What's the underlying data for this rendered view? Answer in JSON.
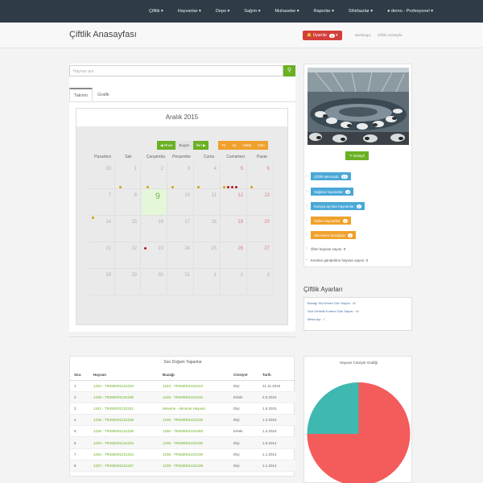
{
  "topnav": {
    "items": [
      "Çiftlik",
      "Hayvanlar",
      "Depo",
      "Sağım",
      "Muhasebe",
      "Raporlar",
      "Sihirbazlar"
    ],
    "user": "demo - Profesyonel"
  },
  "header": {
    "title": "Çiftlik Anasayfası",
    "alert_label": "Uyarılar",
    "alert_count": "1",
    "breadcrumb": [
      "Baslangıç",
      "Çiftlik Anasayfa"
    ]
  },
  "search": {
    "placeholder": "Hayvan ara"
  },
  "tabs": [
    "Takvim",
    "Grafik"
  ],
  "calendar": {
    "title": "Aralık 2015",
    "nav": {
      "prev": "Önce",
      "today": "Bugün",
      "next": "İleri"
    },
    "views": [
      "Yıl",
      "Ay",
      "Hafta",
      "Gün"
    ],
    "day_names": [
      "Pazartesi",
      "Salı",
      "Çarşamba",
      "Perşembe",
      "Cuma",
      "Cumartesi",
      "Pazar"
    ],
    "weeks": [
      [
        "30",
        "1",
        "2",
        "3",
        "4",
        "5",
        "6"
      ],
      [
        "7",
        "8",
        "9",
        "10",
        "11",
        "12",
        "13"
      ],
      [
        "14",
        "15",
        "16",
        "17",
        "18",
        "19",
        "20"
      ],
      [
        "21",
        "22",
        "23",
        "24",
        "25",
        "26",
        "27"
      ],
      [
        "28",
        "29",
        "30",
        "31",
        "1",
        "2",
        "3"
      ]
    ],
    "today": "9",
    "dot_colors": {
      "yellow": "#d6a400",
      "red": "#b21a1a"
    }
  },
  "sidebar": {
    "detail_button": "Detaylı",
    "stats": [
      {
        "label": "Çiftlik Mevcudu",
        "badge": "12",
        "color": "blue"
      },
      {
        "label": "Sağılan hayvanlar",
        "badge": "4",
        "color": "blue"
      },
      {
        "label": "Kuruya ayrılan hayvanlar",
        "badge": "2",
        "color": "blue"
      },
      {
        "label": "Gebe Hayvanlar",
        "badge": "4",
        "color": "orange"
      },
      {
        "label": "Süt emen buzağılar",
        "badge": "2",
        "color": "orange"
      }
    ],
    "text_stats": [
      {
        "label": "Ölen hayvan sayısı:",
        "value": "0"
      },
      {
        "label": "Kesime gönderilen hayvan sayısı:",
        "value": "0"
      }
    ]
  },
  "settings": {
    "title": "Çiftlik Ayarları",
    "lines": [
      {
        "label": "Buzağı Süt Kesim Gün Sayısı:",
        "value": "60"
      },
      {
        "label": "Sod Gebelik Kontrol Gün Sayısı:",
        "value": "60"
      },
      {
        "label": "Mesa Ayı:",
        "value": "1"
      }
    ]
  },
  "births": {
    "title": "Son Doğum Yapanlar",
    "columns": [
      "Sıra",
      "Hayvan",
      "Buzağı",
      "Cinsiyet",
      "Tarih"
    ],
    "rows": [
      [
        "1",
        "1234 - TR450001231234",
        "1243 - TR450001231243",
        "Dişi",
        "21.11.2015"
      ],
      [
        "2",
        "1236 - TR450001231236",
        "1245 - TR450001231245",
        "Erkek",
        "2.5.2015"
      ],
      [
        "3",
        "1241 - TR450001231241",
        "deneme - deneme Hayvan",
        "Dişi",
        "1.5.2015"
      ],
      [
        "4",
        "1236 - TR450001231236",
        "1235 - TR450001231235",
        "Dişi",
        "1.3.2015"
      ],
      [
        "5",
        "1236 - TR450001231236",
        "1250 - TR450001231250",
        "Erkek",
        "1.2.2015"
      ],
      [
        "6",
        "1234 - TR450001231234",
        "1235 - TR450001231235",
        "Dişi",
        "1.9.2014"
      ],
      [
        "7",
        "1234 - TR450001231234",
        "1236 - TR450001231236",
        "Dişi",
        "1.1.2014"
      ],
      [
        "8",
        "1237 - TR450001231237",
        "1238 - TR450001231238",
        "Dişi",
        "1.1.2014"
      ]
    ]
  },
  "chart_data": {
    "type": "pie",
    "title": "Hayvan Cinsiyet Grafiği",
    "values": [
      75,
      25
    ],
    "colors": [
      "#f45b5b",
      "#3fb8af"
    ]
  }
}
